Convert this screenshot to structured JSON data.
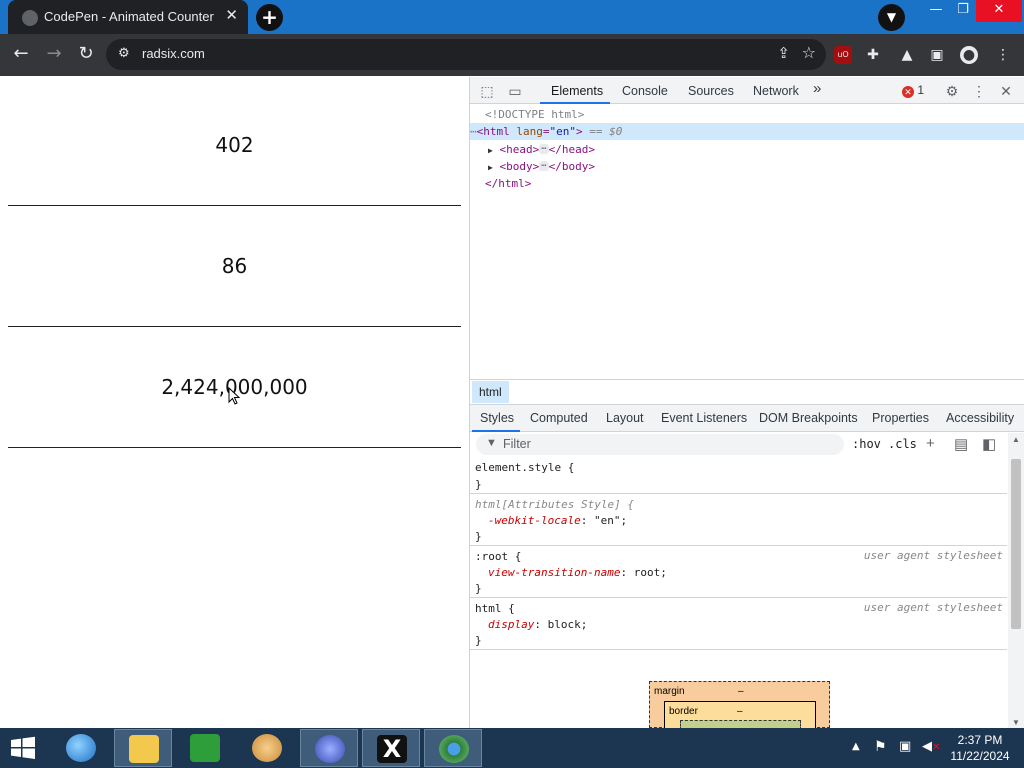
{
  "browser": {
    "tab_title": "CodePen - Animated Counter",
    "tab_close": "✕",
    "new_tab": "+",
    "url": "radsix.com",
    "window_controls": {
      "minimize": "—",
      "maximize": "❐",
      "close": "✕"
    }
  },
  "page": {
    "counters": [
      "402",
      "86",
      "2,424,000,000"
    ]
  },
  "devtools": {
    "tabs": [
      "Elements",
      "Console",
      "Sources",
      "Network"
    ],
    "more_tabs": "»",
    "error_count": "1",
    "dom_lines": {
      "doctype": "<!DOCTYPE html>",
      "html_open_tag": "html",
      "html_attr_name": "lang",
      "html_attr_value": "\"en\"",
      "selected_marker": "== $0",
      "head_tag": "head",
      "body_tag": "body",
      "html_close": "</html>"
    },
    "breadcrumb": "html",
    "subtabs": [
      "Styles",
      "Computed",
      "Layout",
      "Event Listeners",
      "DOM Breakpoints",
      "Properties",
      "Accessibility"
    ],
    "filter_placeholder": "Filter",
    "hov": ":hov",
    "cls": ".cls",
    "rules": [
      {
        "selector": "element.style {",
        "close": "}"
      },
      {
        "selector": "html[Attributes Style] {",
        "prop": "-webkit-locale",
        "value": "\"en\";",
        "close": "}"
      },
      {
        "selector": ":root {",
        "source": "user agent stylesheet",
        "prop": "view-transition-name",
        "value": "root;",
        "close": "}"
      },
      {
        "selector": "html {",
        "source": "user agent stylesheet",
        "prop": "display",
        "value": "block;",
        "close": "}"
      }
    ],
    "box_model": {
      "margin_label": "margin",
      "margin_value": "–",
      "border_label": "border",
      "border_value": "–"
    }
  },
  "taskbar": {
    "time": "2:37 PM",
    "date": "11/22/2024"
  },
  "colors": {
    "tab_bar": "#1a73c7",
    "toolbar": "#35363a",
    "taskbar": "#1c3550",
    "devtools_accent": "#1a73e8"
  }
}
